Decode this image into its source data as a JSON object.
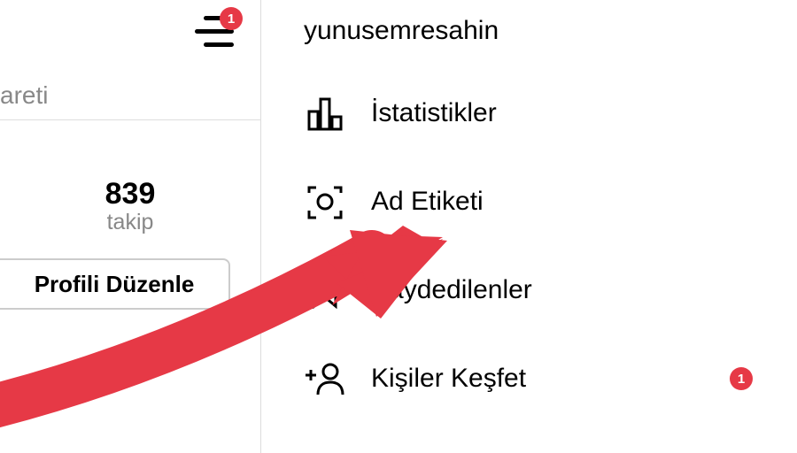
{
  "header": {
    "hamburger_badge": "1"
  },
  "left": {
    "partial_text": "areti",
    "stat_number": "839",
    "stat_label": "takip",
    "edit_button": "Profili Düzenle"
  },
  "right": {
    "username": "yunusemresahin",
    "menu": [
      {
        "label": "İstatistikler",
        "icon": "bar-chart"
      },
      {
        "label": "Ad Etiketi",
        "icon": "scan"
      },
      {
        "label": "Kaydedilenler",
        "icon": "bookmark"
      },
      {
        "label": "Kişiler Keşfet",
        "icon": "add-person",
        "badge": "1"
      }
    ]
  },
  "colors": {
    "badge": "#e63946"
  }
}
